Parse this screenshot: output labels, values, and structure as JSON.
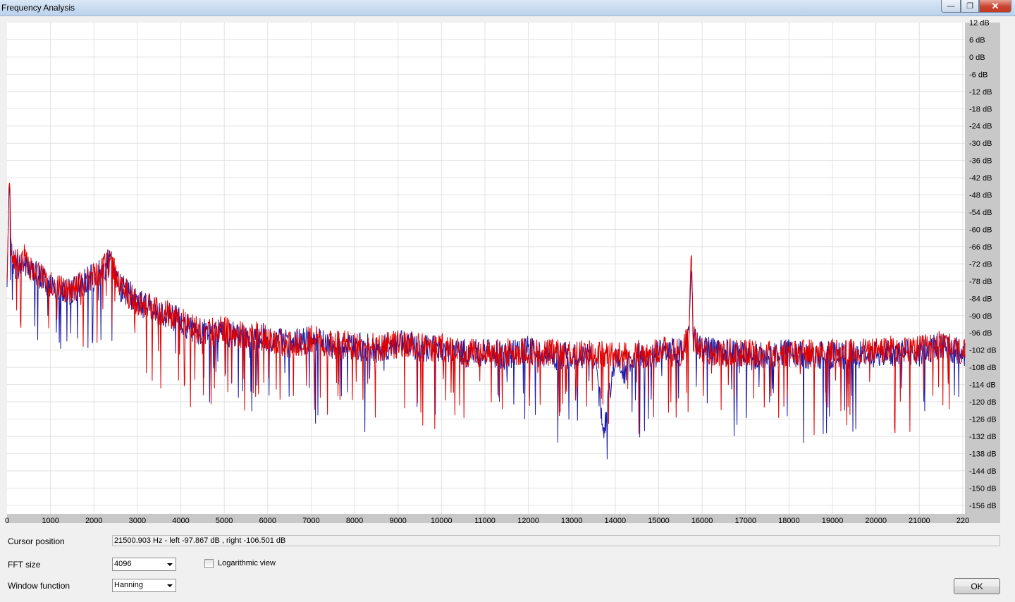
{
  "window": {
    "title": "Frequency Analysis"
  },
  "controls": {
    "minimize_icon": "minimize-icon",
    "maximize_icon": "maximize-icon",
    "close_icon": "close-icon",
    "cursor_label": "Cursor position",
    "cursor_value": "21500.903 Hz  -  left -97.867 dB , right -106.501 dB",
    "fft_label": "FFT size",
    "fft_value": "4096",
    "log_label": "Logarithmic view",
    "log_checked": false,
    "window_label": "Window function",
    "window_value": "Hanning",
    "ok_label": "OK"
  },
  "colors": {
    "left_channel": "#e00000",
    "right_channel": "#1a1aa8",
    "plot_bg": "#ffffff",
    "grid": "#e2e2e2",
    "axis_bg": "#c8c8c8"
  },
  "chart_data": {
    "type": "line",
    "xlabel": "",
    "ylabel": "",
    "xlim": [
      0,
      22050
    ],
    "ylim": [
      -159,
      12
    ],
    "x_ticks": [
      "0",
      "1000",
      "2000",
      "3000",
      "4000",
      "5000",
      "6000",
      "7000",
      "8000",
      "9000",
      "10000",
      "11000",
      "12000",
      "13000",
      "14000",
      "15000",
      "16000",
      "17000",
      "18000",
      "19000",
      "20000",
      "21000",
      "220"
    ],
    "y_ticks": [
      "12 dB",
      "6 dB",
      "0 dB",
      "-6 dB",
      "-12 dB",
      "-18 dB",
      "-24 dB",
      "-30 dB",
      "-36 dB",
      "-42 dB",
      "-48 dB",
      "-54 dB",
      "-60 dB",
      "-66 dB",
      "-72 dB",
      "-78 dB",
      "-84 dB",
      "-90 dB",
      "-96 dB",
      "-102 dB",
      "-108 dB",
      "-114 dB",
      "-120 dB",
      "-126 dB",
      "-132 dB",
      "-138 dB",
      "-144 dB",
      "-150 dB",
      "-156 dB"
    ],
    "grid": true,
    "series": [
      {
        "color": "#1a1aa8",
        "x": [
          0,
          50,
          100,
          200,
          400,
          600,
          800,
          1000,
          1200,
          1400,
          1600,
          1800,
          2000,
          2200,
          2300,
          2400,
          2600,
          3000,
          3400,
          3800,
          4200,
          4600,
          5000,
          5400,
          5800,
          6200,
          6600,
          7000,
          7400,
          7800,
          8200,
          8600,
          9000,
          9500,
          10000,
          10500,
          11000,
          11500,
          12000,
          12500,
          13000,
          13500,
          13750,
          14000,
          14200,
          14500,
          14800,
          15000,
          15500,
          15700,
          15750,
          15800,
          16000,
          16500,
          17000,
          17500,
          18000,
          18500,
          19000,
          19500,
          20000,
          20500,
          21000,
          21500,
          22000
        ],
        "y": [
          -80,
          -42,
          -70,
          -73,
          -72,
          -75,
          -77,
          -79,
          -80,
          -82,
          -80,
          -78,
          -77,
          -74,
          -72,
          -72,
          -80,
          -85,
          -88,
          -90,
          -94,
          -96,
          -96,
          -98,
          -97,
          -99,
          -100,
          -98,
          -100,
          -101,
          -101,
          -102,
          -100,
          -101,
          -102,
          -103,
          -103,
          -104,
          -102,
          -104,
          -104,
          -104,
          -130,
          -103,
          -110,
          -104,
          -106,
          -102,
          -103,
          -96,
          -72,
          -98,
          -102,
          -103,
          -104,
          -104,
          -103,
          -104,
          -104,
          -104,
          -103,
          -103,
          -103,
          -100,
          -103
        ]
      },
      {
        "color": "#e00000",
        "x": [
          0,
          50,
          100,
          200,
          400,
          600,
          800,
          1000,
          1200,
          1400,
          1600,
          1800,
          2000,
          2200,
          2300,
          2400,
          2600,
          3000,
          3400,
          3800,
          4200,
          4600,
          5000,
          5400,
          5800,
          6200,
          6600,
          7000,
          7400,
          7800,
          8200,
          8600,
          9000,
          9500,
          10000,
          10500,
          11000,
          11500,
          12000,
          12500,
          13000,
          13500,
          13750,
          14000,
          14200,
          14500,
          14800,
          15000,
          15500,
          15700,
          15750,
          15800,
          16000,
          16500,
          17000,
          17500,
          18000,
          18500,
          19000,
          19500,
          20000,
          20500,
          21000,
          21500,
          22000
        ],
        "y": [
          -78,
          -41,
          -68,
          -72,
          -70,
          -74,
          -77,
          -79,
          -80,
          -81,
          -80,
          -78,
          -76,
          -74,
          -72,
          -71,
          -80,
          -85,
          -88,
          -90,
          -94,
          -96,
          -95,
          -97,
          -97,
          -99,
          -100,
          -98,
          -100,
          -100,
          -101,
          -101,
          -100,
          -101,
          -101,
          -103,
          -103,
          -103,
          -102,
          -103,
          -103,
          -103,
          -104,
          -103,
          -104,
          -103,
          -105,
          -102,
          -103,
          -96,
          -66,
          -98,
          -102,
          -103,
          -103,
          -103,
          -103,
          -103,
          -103,
          -103,
          -102,
          -102,
          -102,
          -100,
          -103
        ]
      }
    ]
  }
}
